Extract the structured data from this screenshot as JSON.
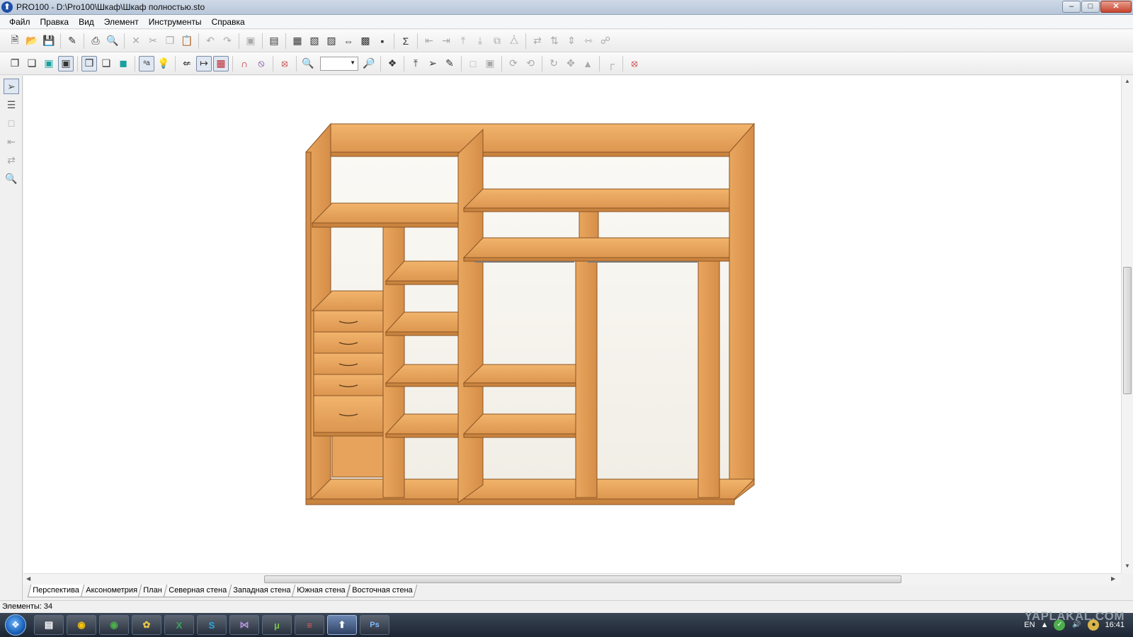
{
  "window": {
    "title": "PRO100 - D:\\Pro100\\Шкаф\\Шкаф полностью.sto",
    "app_icon_glyph": "⬆",
    "controls": [
      "minimize-icon",
      "maximize-icon",
      "close-icon"
    ]
  },
  "menu": [
    "Файл",
    "Правка",
    "Вид",
    "Элемент",
    "Инструменты",
    "Справка"
  ],
  "toolbar1": {
    "icons": [
      "new-file-icon",
      "open-icon",
      "save-icon",
      "export-icon",
      "print-icon",
      "print-preview-icon",
      "cut-icon",
      "scissors-icon",
      "copy-icon",
      "paste-icon",
      "undo-icon",
      "redo-icon",
      "properties-icon",
      "settings-dialog-icon",
      "view-a-icon",
      "view-b-icon",
      "view-c-icon",
      "view-d-icon",
      "view-e-icon",
      "sum-icon",
      "align-left-icon",
      "align-right-icon",
      "align-top-icon",
      "align-bottom-icon",
      "group-icon",
      "ungroup-icon",
      "distribute-h-icon",
      "distribute-v-icon",
      "space-h-icon",
      "space-v-icon",
      "link-icon"
    ]
  },
  "toolbar2": {
    "zoom_value": "",
    "icons": [
      "front-view-icon",
      "box-view-icon",
      "solid-view-icon",
      "wireframe-view-icon",
      "outline-view-icon",
      "shadow-view-icon",
      "texture-view-icon",
      "labels-icon",
      "light-icon",
      "dimensions-icon",
      "measure-icon",
      "grid-icon",
      "magnet-icon",
      "snap-icon",
      "target-icon",
      "zoom-in-icon",
      "zoom-out-icon",
      "select-all-icon",
      "move-up-icon",
      "pointer-icon",
      "pencil-icon",
      "resize-icon",
      "scale-icon",
      "rotate-x-icon",
      "rotate-y-icon",
      "rotate-icon",
      "move-icon",
      "mirror-icon",
      "corner-icon",
      "lifebuoy-icon"
    ]
  },
  "left_tools": [
    "select-tool-icon",
    "layer-tool-icon",
    "rect-tool-icon",
    "place-tool-icon",
    "arrange-tool-icon",
    "search-tool-icon"
  ],
  "tabs": [
    "Перспектива",
    "Аксонометрия",
    "План",
    "Северная стена",
    "Западная стена",
    "Южная стена",
    "Восточная стена"
  ],
  "active_tab": "Перспектива",
  "status": "Элементы: 34",
  "taskbar": {
    "apps": [
      "explorer-icon",
      "chrome-icon",
      "chrome-alt-icon",
      "winamp-icon",
      "excel-icon",
      "skype-icon",
      "visual-studio-icon",
      "utorrent-icon",
      "flag-icon",
      "pro100-icon",
      "photoshop-icon"
    ],
    "app_glyphs": [
      "▤",
      "◉",
      "◉",
      "✿",
      "X",
      "S",
      "⋈",
      "μ",
      "≡",
      "⬆",
      "Ps"
    ],
    "active_app": "pro100-icon",
    "language": "EN",
    "clock": "16:41"
  },
  "watermark": "YAPLAKAL.COM",
  "colors": {
    "wood": "#E8A35A",
    "wood_dark": "#C9843F",
    "wood_edge": "#8A5424",
    "back_panel": "#F6F4EE"
  }
}
